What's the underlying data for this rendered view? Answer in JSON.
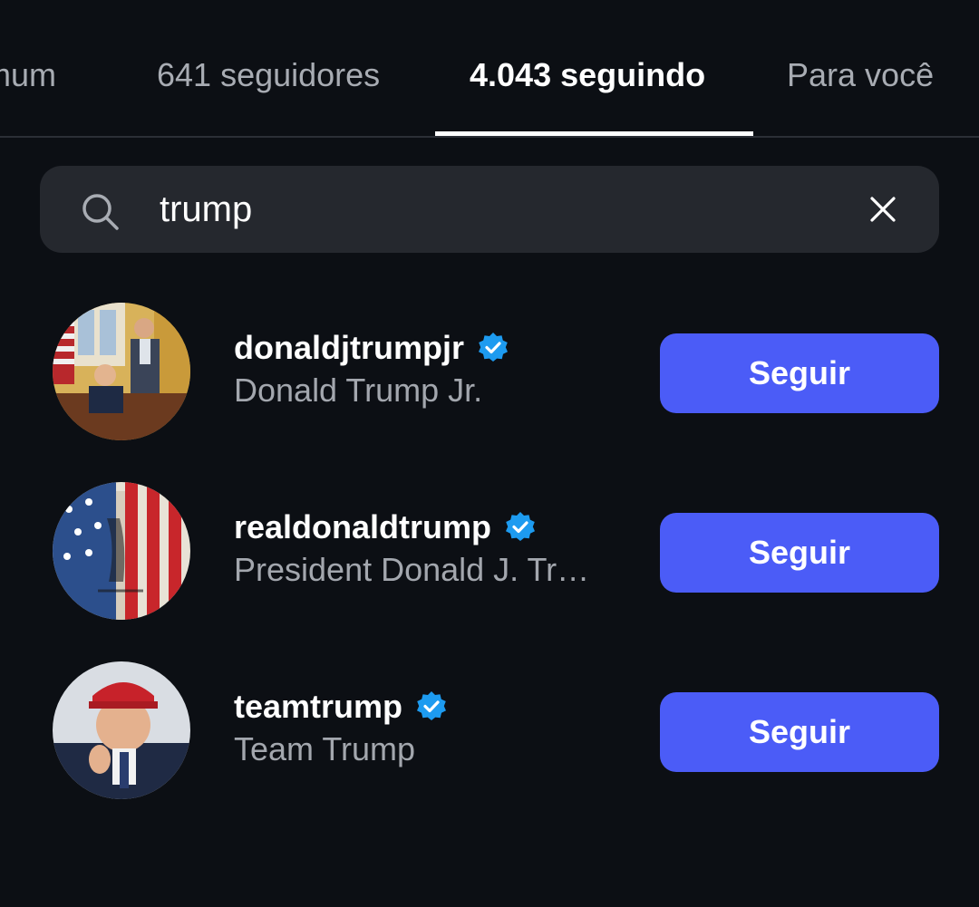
{
  "tabs": [
    {
      "label": "omum",
      "active": false
    },
    {
      "label": "641 seguidores",
      "active": false
    },
    {
      "label": "4.043 seguindo",
      "active": true
    },
    {
      "label": "Para você",
      "active": false
    }
  ],
  "search": {
    "value": "trump",
    "icon": "search-icon",
    "clear_icon": "close-icon"
  },
  "results": [
    {
      "username": "donaldjtrumpjr",
      "display_name": "Donald Trump Jr.",
      "verified": true,
      "button_label": "Seguir"
    },
    {
      "username": "realdonaldtrump",
      "display_name": "President Donald J. Tr…",
      "verified": true,
      "button_label": "Seguir"
    },
    {
      "username": "teamtrump",
      "display_name": "Team Trump",
      "verified": true,
      "button_label": "Seguir"
    }
  ],
  "colors": {
    "background": "#0c0f14",
    "search_bg": "#25282e",
    "button": "#4b5cf7",
    "verified": "#1d9bf0",
    "muted_text": "#a3a7ae"
  }
}
